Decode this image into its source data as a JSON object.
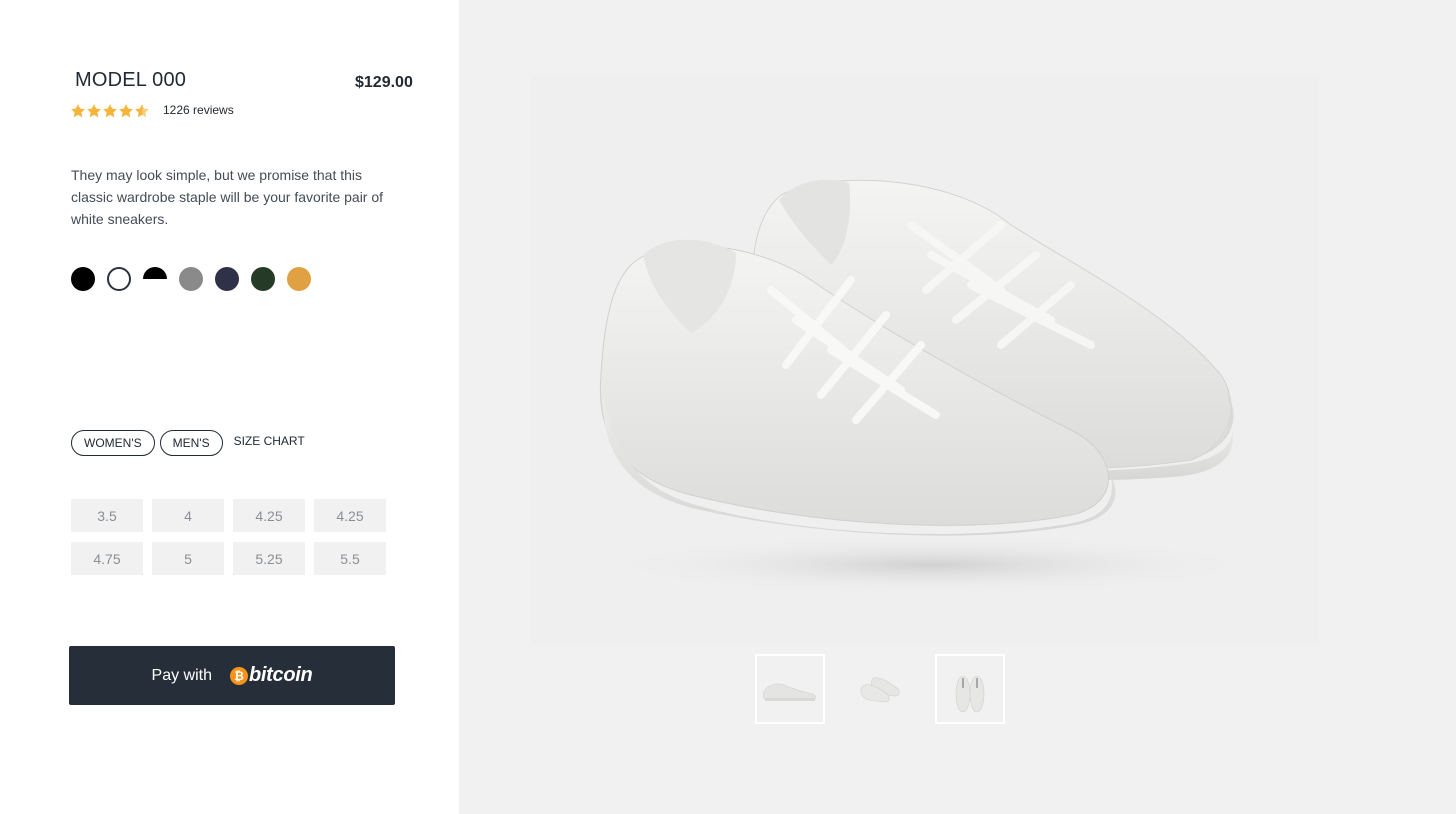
{
  "product": {
    "title": "MODEL 000",
    "price": "$129.00",
    "rating_stars": 4.5,
    "reviews": "1226 reviews",
    "description": "They may look simple, but we promise that this classic wardrobe staple will be your favorite pair of white sneakers."
  },
  "colors": [
    {
      "name": "black",
      "hex": "#000000"
    },
    {
      "name": "white",
      "hex": "#ffffff",
      "selected": true
    },
    {
      "name": "black-white",
      "hex": "#000000/#ffffff"
    },
    {
      "name": "gray",
      "hex": "#8a8a8a"
    },
    {
      "name": "navy",
      "hex": "#2e3148"
    },
    {
      "name": "green",
      "hex": "#253b28"
    },
    {
      "name": "gold",
      "hex": "#e0a142"
    }
  ],
  "gender_tabs": {
    "womens": "WOMEN'S",
    "mens": "MEN'S",
    "size_chart": "SIZE CHART"
  },
  "sizes": [
    "3.5",
    "4",
    "4.25",
    "4.25",
    "4.75",
    "5",
    "5.25",
    "5.5"
  ],
  "pay_button": {
    "label": "Pay with",
    "brand": "bitcoin",
    "brand_symbol": "₿"
  },
  "gallery": {
    "thumbnails": [
      "side-view",
      "pair-angle-view",
      "top-view"
    ]
  },
  "theme": {
    "accent_star": "#f5b43c",
    "button_bg": "#262e39",
    "bitcoin_orange": "#f7931a"
  }
}
